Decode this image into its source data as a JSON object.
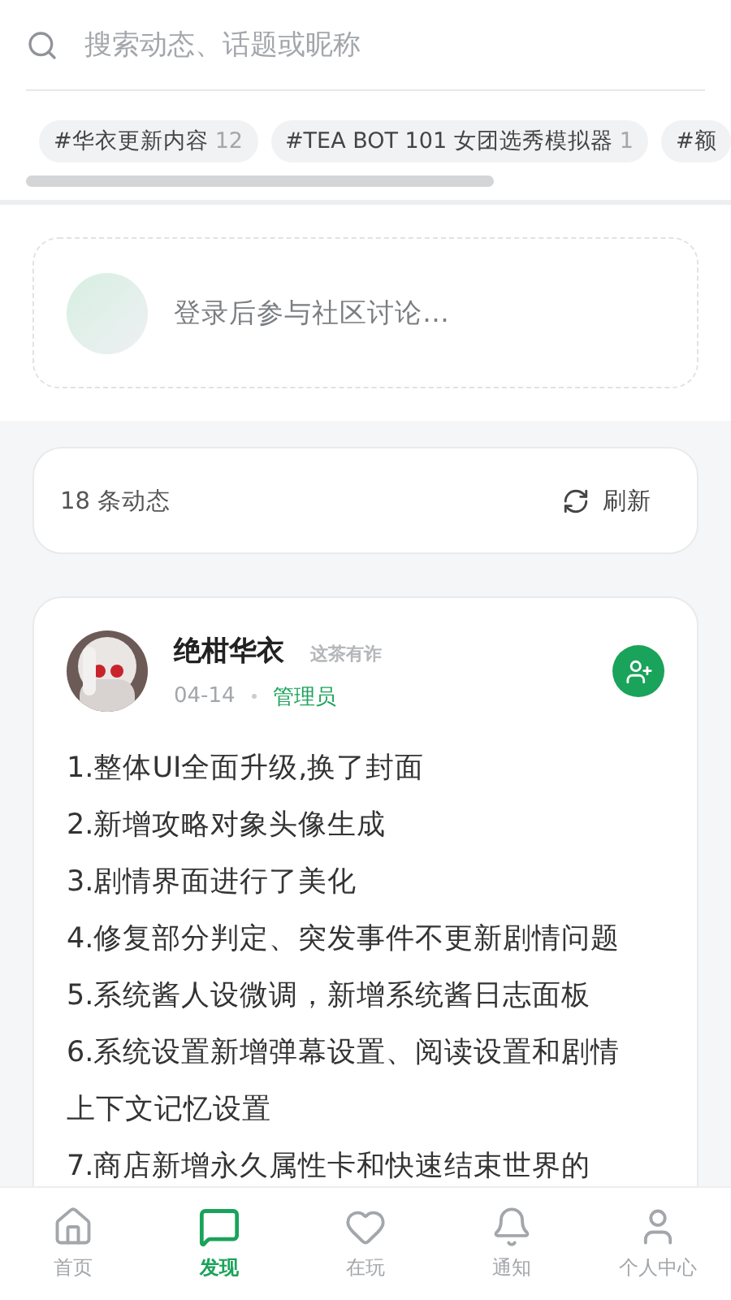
{
  "search": {
    "placeholder": "搜索动态、话题或昵称"
  },
  "topics": [
    {
      "label": "#华衣更新内容",
      "count": "12"
    },
    {
      "label": "#TEA BOT 101 女团选秀模拟器",
      "count": "1"
    },
    {
      "label": "#额"
    }
  ],
  "compose": {
    "placeholder": "登录后参与社区讨论…"
  },
  "feed_header": {
    "count": "18 条动态",
    "refresh": "刷新"
  },
  "post": {
    "author": "绝柑华衣",
    "tag": "这茶有诈",
    "date": "04-14",
    "role": "管理员",
    "lines": [
      "1.整体UI全面升级,换了封面",
      "2.新增攻略对象头像生成",
      "3.剧情界面进行了美化",
      "4.修复部分判定、突发事件不更新剧情问题",
      "5.系统酱人设微调，新增系统酱日志面板",
      "6.系统设置新增弹幕设置、阅读设置和剧情上下文记忆设置",
      "7.商店新增永久属性卡和快速结束世界的"
    ]
  },
  "nav": [
    {
      "label": "首页",
      "selected": false
    },
    {
      "label": "发现",
      "selected": true
    },
    {
      "label": "在玩",
      "selected": false
    },
    {
      "label": "通知",
      "selected": false
    },
    {
      "label": "个人中心",
      "selected": false
    }
  ]
}
